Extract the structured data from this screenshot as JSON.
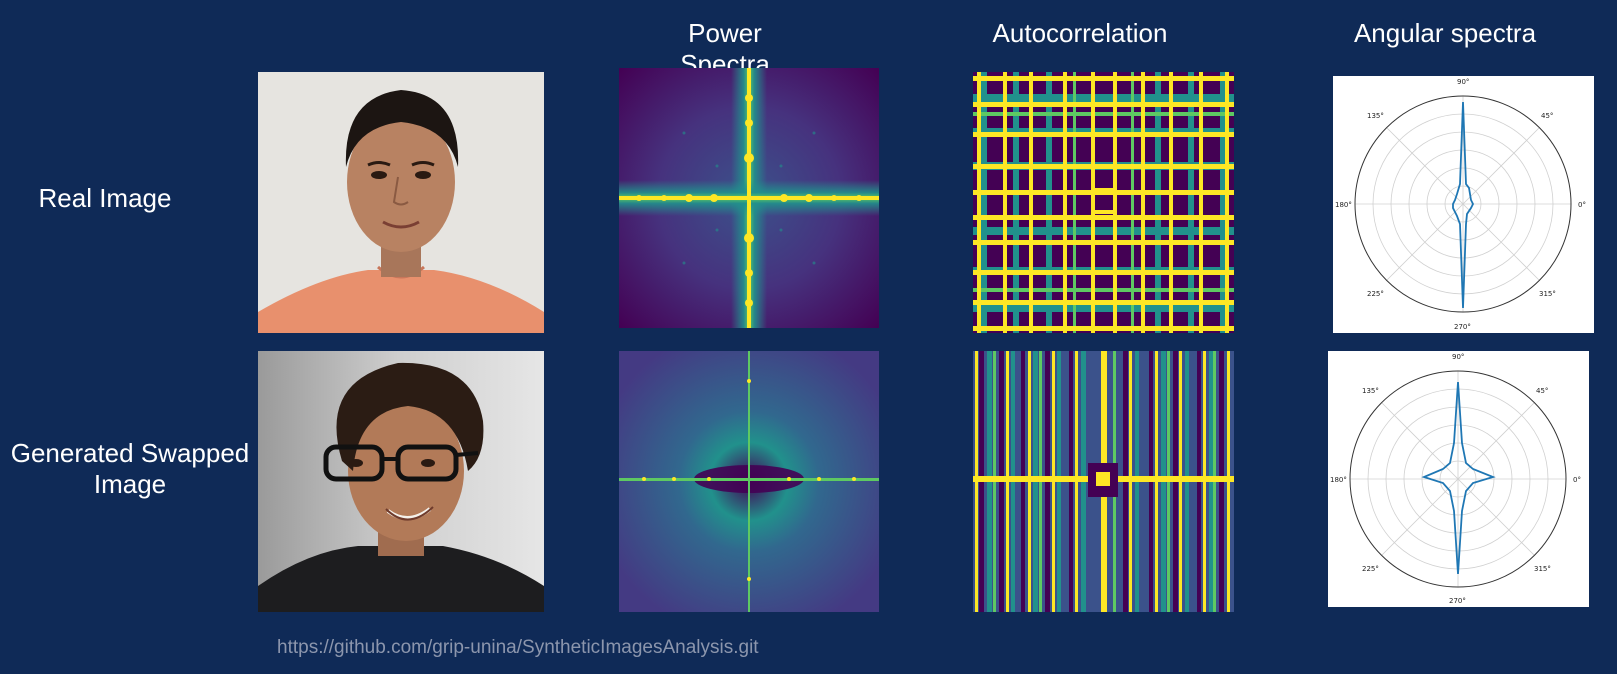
{
  "columns": {
    "power": "Power Spectra",
    "autocorr": "Autocorrelation",
    "angular": "Angular spectra"
  },
  "rows": {
    "real": "Real Image",
    "generated_line1": "Generated Swapped",
    "generated_line2": "Image"
  },
  "footer": {
    "link": "https://github.com/grip-unina/SyntheticImagesAnalysis.git"
  },
  "polar": {
    "angle_labels": [
      "90°",
      "45°",
      "0°",
      "315°",
      "270°",
      "225°",
      "180°",
      "135°"
    ]
  },
  "colors": {
    "background": "#0f2a57",
    "viridis_dark": "#440154",
    "viridis_teal": "#21918c",
    "viridis_green": "#5ec962",
    "viridis_yellow": "#fde725",
    "polar_line": "#1f77b4"
  }
}
